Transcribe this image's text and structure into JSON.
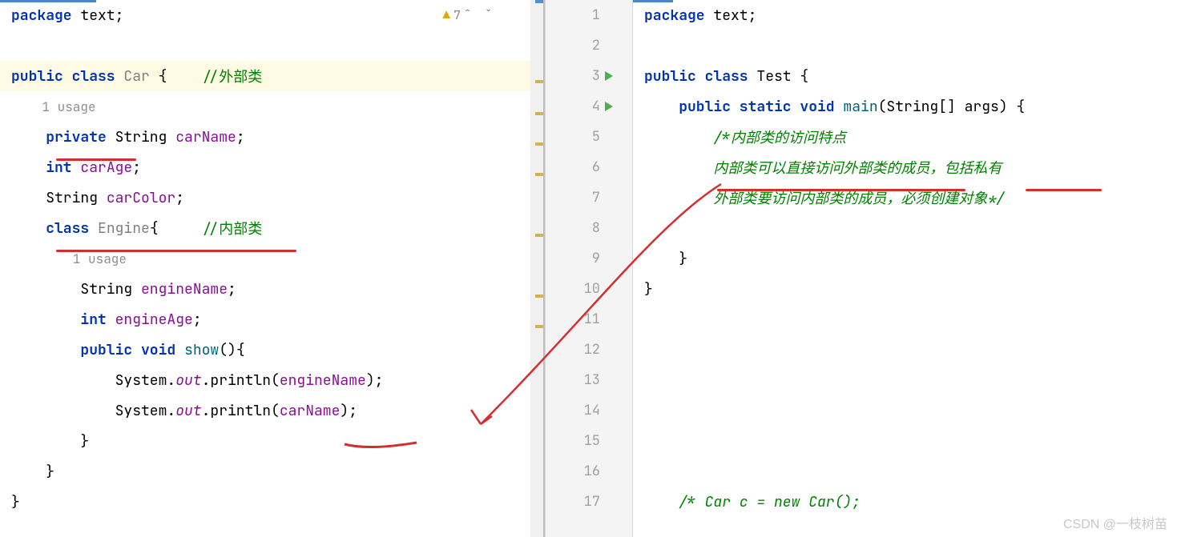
{
  "left": {
    "warning_count": "7",
    "lines": [
      {
        "type": "code",
        "tokens": [
          [
            "kw",
            "package"
          ],
          [
            "",
            " text;"
          ]
        ]
      },
      {
        "type": "blank"
      },
      {
        "type": "code",
        "hl": true,
        "tokens": [
          [
            "kw",
            "public class"
          ],
          [
            "",
            " "
          ],
          [
            "cls",
            "Car"
          ],
          [
            "",
            " {    "
          ],
          [
            "cmt",
            "//外部类"
          ]
        ]
      },
      {
        "type": "usage",
        "text": "1 usage"
      },
      {
        "type": "code",
        "tokens": [
          [
            "",
            "    "
          ],
          [
            "kw",
            "private"
          ],
          [
            "",
            " String "
          ],
          [
            "fld",
            "carName"
          ],
          [
            "",
            ";"
          ]
        ]
      },
      {
        "type": "code",
        "tokens": [
          [
            "",
            "    "
          ],
          [
            "kw",
            "int"
          ],
          [
            "",
            " "
          ],
          [
            "fld",
            "carAge"
          ],
          [
            "",
            ";"
          ]
        ]
      },
      {
        "type": "code",
        "tokens": [
          [
            "",
            "    String "
          ],
          [
            "fld",
            "carColor"
          ],
          [
            "",
            ";"
          ]
        ]
      },
      {
        "type": "code",
        "tokens": [
          [
            "",
            "    "
          ],
          [
            "kw",
            "class"
          ],
          [
            "",
            " "
          ],
          [
            "cls",
            "Engine"
          ],
          [
            "",
            "{     "
          ],
          [
            "cmt",
            "//内部类"
          ]
        ]
      },
      {
        "type": "usage",
        "text": "1 usage",
        "indent": 2
      },
      {
        "type": "code",
        "tokens": [
          [
            "",
            "        String "
          ],
          [
            "fld",
            "engineName"
          ],
          [
            "",
            ";"
          ]
        ]
      },
      {
        "type": "code",
        "tokens": [
          [
            "",
            "        "
          ],
          [
            "kw",
            "int"
          ],
          [
            "",
            " "
          ],
          [
            "fld",
            "engineAge"
          ],
          [
            "",
            ";"
          ]
        ]
      },
      {
        "type": "code",
        "tokens": [
          [
            "",
            "        "
          ],
          [
            "kw",
            "public void"
          ],
          [
            "",
            " "
          ],
          [
            "fn",
            "show"
          ],
          [
            "",
            "(){"
          ]
        ]
      },
      {
        "type": "code",
        "tokens": [
          [
            "",
            "            System."
          ],
          [
            "out-it",
            "out"
          ],
          [
            "",
            ".println("
          ],
          [
            "fld",
            "engineName"
          ],
          [
            "",
            ");"
          ]
        ]
      },
      {
        "type": "code",
        "tokens": [
          [
            "",
            "            System."
          ],
          [
            "out-it",
            "out"
          ],
          [
            "",
            ".println("
          ],
          [
            "fld",
            "carName"
          ],
          [
            "",
            ");"
          ]
        ]
      },
      {
        "type": "code",
        "tokens": [
          [
            "",
            "        }"
          ]
        ]
      },
      {
        "type": "code",
        "tokens": [
          [
            "",
            "    }"
          ]
        ]
      },
      {
        "type": "code",
        "tokens": [
          [
            "",
            "}"
          ]
        ]
      }
    ]
  },
  "right": {
    "line_numbers": [
      "1",
      "2",
      "3",
      "4",
      "5",
      "6",
      "7",
      "8",
      "9",
      "10",
      "11",
      "12",
      "13",
      "14",
      "15",
      "16",
      "17"
    ],
    "run_lines": [
      3,
      4
    ],
    "lines": [
      {
        "tokens": [
          [
            "kw",
            "package"
          ],
          [
            "",
            " text;"
          ]
        ]
      },
      {
        "tokens": []
      },
      {
        "tokens": [
          [
            "kw",
            "public class"
          ],
          [
            "",
            " Test {"
          ]
        ]
      },
      {
        "tokens": [
          [
            "",
            "    "
          ],
          [
            "kw",
            "public static void"
          ],
          [
            "",
            " "
          ],
          [
            "fn",
            "main"
          ],
          [
            "",
            "(String[] args) {"
          ]
        ]
      },
      {
        "tokens": [
          [
            "",
            "        "
          ],
          [
            "cmt-it",
            "/*内部类的访问特点"
          ]
        ]
      },
      {
        "tokens": [
          [
            "",
            "        "
          ],
          [
            "cmt-it",
            "内部类可以直接访问外部类的成员，包括私有"
          ]
        ]
      },
      {
        "tokens": [
          [
            "",
            "        "
          ],
          [
            "cmt-it",
            "外部类要访问内部类的成员，必须创建对象*/"
          ]
        ]
      },
      {
        "tokens": []
      },
      {
        "tokens": [
          [
            "",
            "    }"
          ]
        ]
      },
      {
        "tokens": [
          [
            "",
            "}"
          ]
        ]
      },
      {
        "tokens": []
      },
      {
        "tokens": []
      },
      {
        "tokens": []
      },
      {
        "tokens": []
      },
      {
        "tokens": []
      },
      {
        "tokens": []
      },
      {
        "tokens": [
          [
            "",
            "    "
          ],
          [
            "cmt-it",
            "/* Car c = new Car();"
          ]
        ]
      }
    ]
  },
  "watermark": "CSDN @一枝树苗"
}
